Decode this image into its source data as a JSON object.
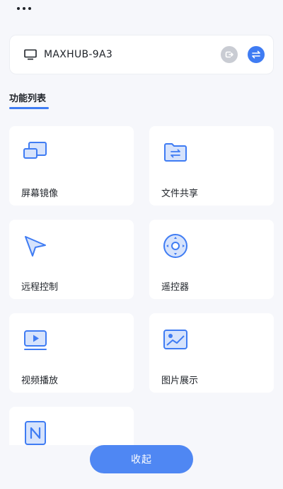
{
  "header": {
    "more_icon": "more-dots-icon"
  },
  "device": {
    "icon": "monitor-icon",
    "name": "MAXHUB-9A3",
    "actions": [
      {
        "icon": "disconnect-icon",
        "color": "#c9ccd3"
      },
      {
        "icon": "switch-arrows-icon",
        "color": "#3f7cf3"
      }
    ]
  },
  "feature_list": {
    "title": "功能列表",
    "items": [
      {
        "label": "屏幕镜像",
        "icon": "screen-mirror-icon"
      },
      {
        "label": "文件共享",
        "icon": "folder-share-icon"
      },
      {
        "label": "远程控制",
        "icon": "cursor-arrow-icon"
      },
      {
        "label": "遥控器",
        "icon": "remote-dpad-icon"
      },
      {
        "label": "视频播放",
        "icon": "video-play-icon"
      },
      {
        "label": "图片展示",
        "icon": "image-icon"
      },
      {
        "label": "",
        "icon": "nfc-icon"
      }
    ]
  },
  "collapse_button": {
    "label": "收起"
  },
  "colors": {
    "accent": "#3f7cf3",
    "icon_fill": "#d6e3fc",
    "background": "#f6f7fb"
  }
}
